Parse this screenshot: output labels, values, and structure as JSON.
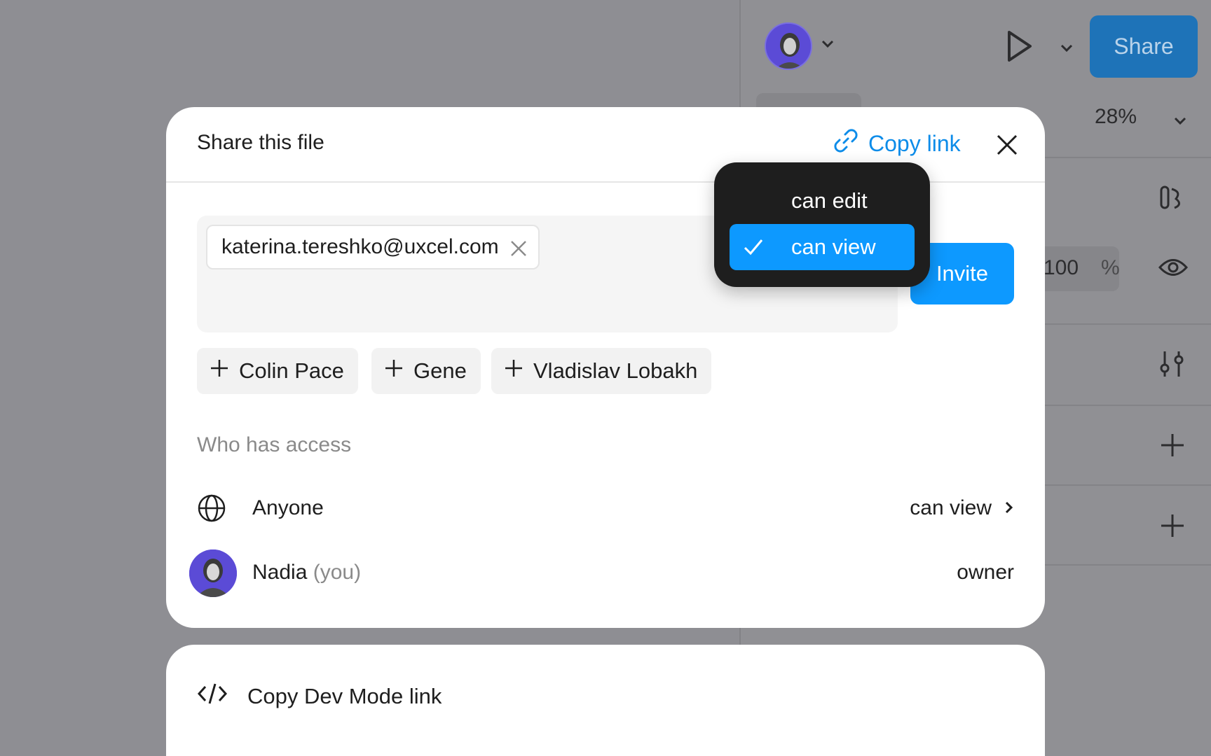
{
  "right_panel": {
    "share_label": "Share",
    "zoom": "28%",
    "opacity_value": "100",
    "opacity_unit": "%"
  },
  "modal": {
    "title": "Share this file",
    "copy_link_label": "Copy link",
    "email_chip": "katerina.tereshko@uxcel.com",
    "invite_label": "Invite",
    "suggestions": [
      "Colin Pace",
      "Gene",
      "Vladislav Lobakh"
    ],
    "access_label": "Who has access",
    "access_rows": [
      {
        "name": "Anyone",
        "permission": "can view"
      },
      {
        "name": "Nadia",
        "suffix": "(you)",
        "permission": "owner"
      }
    ]
  },
  "dropdown": {
    "options": [
      {
        "label": "can edit",
        "selected": false
      },
      {
        "label": "can view",
        "selected": true
      }
    ]
  },
  "lower_card": {
    "dev_mode_label": "Copy Dev Mode link"
  },
  "colors": {
    "accent": "#0d99ff",
    "link": "#0d8ce9",
    "dropdown_bg": "#1e1e1e",
    "overlay": "#8e8e93"
  }
}
